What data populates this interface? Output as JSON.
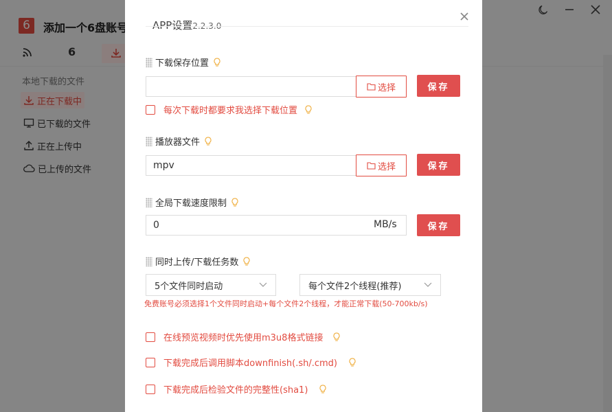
{
  "background": {
    "logo_char": "6",
    "app_title": "添加一个6盘账号",
    "toolbar_number": "6",
    "sidebar_section": "本地下载的文件",
    "nav": [
      {
        "label": "正在下载中"
      },
      {
        "label": "已下载的文件"
      },
      {
        "label": "正在上传中"
      },
      {
        "label": "已上传的文件"
      }
    ]
  },
  "modal": {
    "title": "APP设置",
    "version": "2.2.3.0",
    "download_location": {
      "label": "下载保存位置",
      "value": "",
      "choose_label": "选择",
      "save_label": "保存",
      "ask_checkbox_label": "每次下载时都要求我选择下载位置"
    },
    "player": {
      "label": "播放器文件",
      "value": "mpv",
      "choose_label": "选择",
      "save_label": "保存"
    },
    "speed_limit": {
      "label": "全局下载速度限制",
      "value": "0",
      "unit": "MB/s",
      "save_label": "保存"
    },
    "tasks": {
      "label": "同时上传/下载任务数",
      "files_select": "5个文件同时启动",
      "threads_select": "每个文件2个线程(推荐)",
      "note": "免费账号必须选择1个文件同时启动+每个文件2个线程，才能正常下载(50-700kb/s)"
    },
    "options": [
      {
        "label": "在线预览视频时优先使用m3u8格式链接"
      },
      {
        "label": "下载完成后调用脚本downfinish(.sh/.cmd)"
      },
      {
        "label": "下载完成后检验文件的完整性(sha1)"
      }
    ]
  },
  "colors": {
    "accent": "#e24b40",
    "bulb": "#f0b34a"
  }
}
